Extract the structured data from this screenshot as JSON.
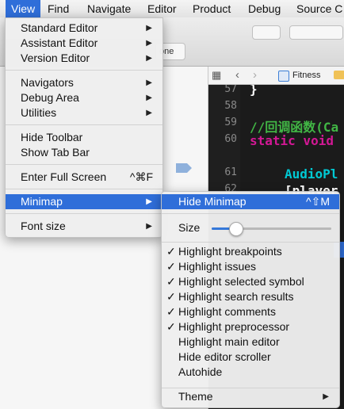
{
  "menubar": {
    "items": [
      "View",
      "Find",
      "Navigate",
      "Editor",
      "Product",
      "Debug",
      "Source C"
    ],
    "active": "View"
  },
  "toolbar": {
    "scheme_fragment": "one"
  },
  "jumpbar": {
    "file": "Fitness"
  },
  "editor": {
    "line_numbers": [
      "57",
      "58",
      "59",
      "60",
      "61",
      "62",
      "63"
    ],
    "lines": [
      "}",
      "",
      "//回调函数(Ca",
      "static void",
      "",
      "AudioPl",
      "[player"
    ]
  },
  "view_menu": {
    "groups": [
      [
        {
          "label": "Standard Editor",
          "submenu": true
        },
        {
          "label": "Assistant Editor",
          "submenu": true
        },
        {
          "label": "Version Editor",
          "submenu": true
        }
      ],
      [
        {
          "label": "Navigators",
          "submenu": true
        },
        {
          "label": "Debug Area",
          "submenu": true
        },
        {
          "label": "Utilities",
          "submenu": true
        }
      ],
      [
        {
          "label": "Hide Toolbar"
        },
        {
          "label": "Show Tab Bar"
        }
      ],
      [
        {
          "label": "Enter Full Screen",
          "shortcut": "^⌘F"
        }
      ],
      [
        {
          "label": "Minimap",
          "submenu": true,
          "highlighted": true
        }
      ],
      [
        {
          "label": "Font size",
          "submenu": true
        }
      ]
    ]
  },
  "minimap_menu": {
    "hide": {
      "label": "Hide Minimap",
      "shortcut": "^⇧M"
    },
    "size": {
      "label": "Size",
      "value_fraction": 0.2
    },
    "options": [
      {
        "label": "Highlight breakpoints",
        "checked": true
      },
      {
        "label": "Highlight issues",
        "checked": true
      },
      {
        "label": "Highlight selected symbol",
        "checked": true
      },
      {
        "label": "Highlight search results",
        "checked": true
      },
      {
        "label": "Highlight comments",
        "checked": true
      },
      {
        "label": "Highlight preprocessor",
        "checked": true
      },
      {
        "label": "Highlight main editor",
        "checked": false
      },
      {
        "label": "Hide editor scroller",
        "checked": false
      },
      {
        "label": "Autohide",
        "checked": false
      }
    ],
    "theme": {
      "label": "Theme"
    }
  },
  "colors": {
    "highlight": "#2f6ed9",
    "comment": "#41b645",
    "keyword": "#d31895",
    "function": "#00c9d4"
  }
}
